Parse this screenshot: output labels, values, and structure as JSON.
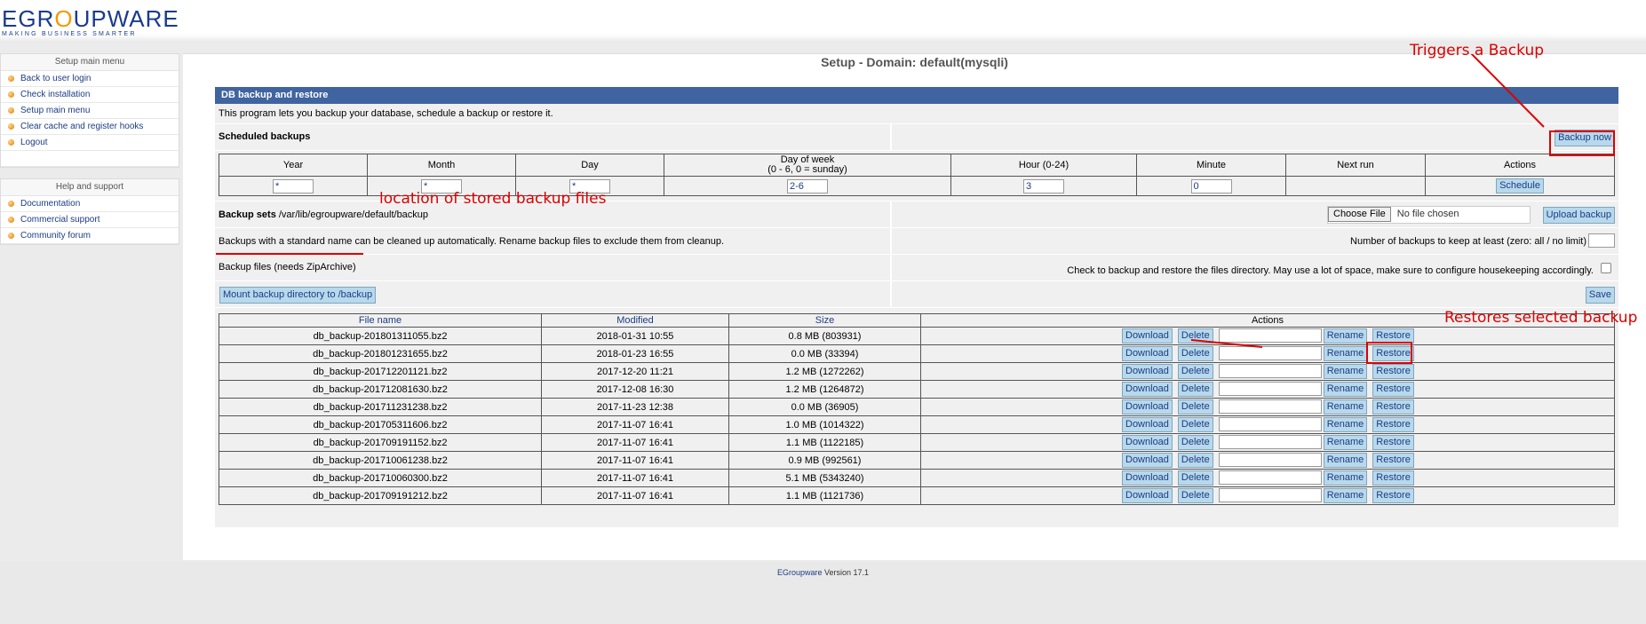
{
  "logo": {
    "text_e": "E",
    "text_g": "G",
    "text_o": "O",
    "text_rest": "UPWARE",
    "text_r": "R",
    "tagline": "MAKING BUSINESS SMARTER"
  },
  "sidebar": {
    "setup_title": "Setup main menu",
    "setup_items": [
      "Back to user login",
      "Check installation",
      "Setup main menu",
      "Clear cache and register hooks",
      "Logout"
    ],
    "help_title": "Help and support",
    "help_items": [
      "Documentation",
      "Commercial support",
      "Community forum"
    ]
  },
  "page": {
    "title": "Setup - Domain: default(mysqli)"
  },
  "panel": {
    "heading": "DB backup and restore",
    "intro": "This program lets you backup your database, schedule a backup or restore it.",
    "scheduled_label": "Scheduled backups",
    "backup_now": "Backup now",
    "schedule": {
      "headers": [
        "Year",
        "Month",
        "Day",
        "Day of week",
        "Hour (0-24)",
        "Minute",
        "Next run",
        "Actions"
      ],
      "dow_hint": "(0 - 6, 0 = sunday)",
      "values": {
        "year": "*",
        "month": "*",
        "day": "*",
        "dow": "2-6",
        "hour": "3",
        "minute": "0"
      },
      "schedule_button": "Schedule"
    },
    "backup_sets_label": "Backup sets",
    "backup_path": "/var/lib/egroupware/default/backup",
    "choose_file": "Choose File",
    "no_file": "No file chosen",
    "upload_backup": "Upload backup",
    "cleanup_text": "Backups with a standard name can be cleaned up automatically. Rename backup files to exclude them from cleanup.",
    "keep_label": "Number of backups to keep at least (zero: all / no limit)",
    "files_label": "Backup files (needs ZipArchive)",
    "files_check_label": "Check to backup and restore the files directory. May use a lot of space, make sure to configure housekeeping accordingly.",
    "mount_button": "Mount backup directory to /backup",
    "save_button": "Save",
    "files_table": {
      "headers": [
        "File name",
        "Modified",
        "Size",
        "Actions"
      ],
      "rows": [
        {
          "name": "db_backup-201801311055.bz2",
          "modified": "2018-01-31 10:55",
          "size": "0.8 MB (803931)"
        },
        {
          "name": "db_backup-201801231655.bz2",
          "modified": "2018-01-23 16:55",
          "size": "0.0 MB (33394)"
        },
        {
          "name": "db_backup-201712201121.bz2",
          "modified": "2017-12-20 11:21",
          "size": "1.2 MB (1272262)"
        },
        {
          "name": "db_backup-201712081630.bz2",
          "modified": "2017-12-08 16:30",
          "size": "1.2 MB (1264872)"
        },
        {
          "name": "db_backup-201711231238.bz2",
          "modified": "2017-11-23 12:38",
          "size": "0.0 MB (36905)"
        },
        {
          "name": "db_backup-201705311606.bz2",
          "modified": "2017-11-07 16:41",
          "size": "1.0 MB (1014322)"
        },
        {
          "name": "db_backup-201709191152.bz2",
          "modified": "2017-11-07 16:41",
          "size": "1.1 MB (1122185)"
        },
        {
          "name": "db_backup-201710061238.bz2",
          "modified": "2017-11-07 16:41",
          "size": "0.9 MB (992561)"
        },
        {
          "name": "db_backup-201710060300.bz2",
          "modified": "2017-11-07 16:41",
          "size": "5.1 MB (5343240)"
        },
        {
          "name": "db_backup-201709191212.bz2",
          "modified": "2017-11-07 16:41",
          "size": "1.1 MB (1121736)"
        }
      ],
      "actions": {
        "download": "Download",
        "delete": "Delete",
        "rename": "Rename",
        "restore": "Restore"
      }
    }
  },
  "annotations": {
    "backup": "Triggers a Backup",
    "location": "location of stored backup files",
    "restore": "Restores selected backup",
    "color": "#dd0000"
  },
  "footer": {
    "link": "EGroupware",
    "version": "Version 17.1"
  }
}
